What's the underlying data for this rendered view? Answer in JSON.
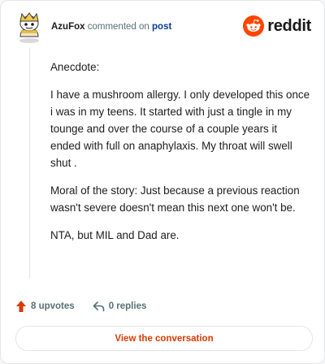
{
  "header": {
    "author": "AzuFox",
    "action_text": "commented on",
    "post_link": "post",
    "logo_text": "reddit",
    "avatar_icon": "snoo-avatar-icon",
    "logo_icon": "reddit-snoo-icon"
  },
  "comment": {
    "paragraphs": [
      "Anecdote:",
      "I have a mushroom allergy. I only developed this once i was in my teens. It started with just a tingle in my tounge and over the course of a couple years it ended with full on anaphylaxis. My throat will swell shut .",
      "Moral of the story: Just because a previous reaction wasn't severe doesn't mean this next one won't be.",
      "NTA, but MIL and Dad are."
    ]
  },
  "actions": {
    "upvotes": "8 upvotes",
    "replies": "0 replies",
    "upvote_icon": "upvote-arrow-icon",
    "reply_icon": "reply-icon"
  },
  "cta": {
    "label": "View the conversation"
  },
  "colors": {
    "brand": "#ff4500",
    "cta_text": "#d93a00",
    "link": "#0a3d91",
    "muted": "#576f76"
  }
}
